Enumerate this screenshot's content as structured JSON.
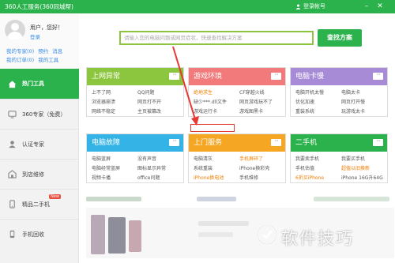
{
  "window": {
    "title": "360人工服务(360同城帮)",
    "login_label": "登录帐号",
    "minimize_icon": "minimize-icon",
    "close_icon": "close-icon"
  },
  "user": {
    "greeting": "用户，您好！",
    "logout": "登录",
    "links_row1": [
      "我的专家(0)",
      "预约",
      "消息"
    ],
    "links_row2": [
      "我的订单(0)",
      "我的工具"
    ]
  },
  "sidebar": {
    "items": [
      {
        "label": "热门工具",
        "icon": "home-icon",
        "active": true
      },
      {
        "label": "360专家（免费）",
        "icon": "expert-icon",
        "active": false
      },
      {
        "label": "认证专家",
        "icon": "certified-icon",
        "active": false
      },
      {
        "label": "到店维修",
        "icon": "repair-icon",
        "active": false
      },
      {
        "label": "精品二手机",
        "icon": "phone-icon",
        "active": false,
        "badge": "New"
      },
      {
        "label": "手机回收",
        "icon": "recycle-icon",
        "active": false
      }
    ]
  },
  "search": {
    "placeholder": "请输入您的电脑问题或网页症状，快速查找解决方案",
    "button": "查找方案"
  },
  "cards": [
    {
      "title": "上网异常",
      "color": "#8cc63f",
      "items": [
        "上不了网",
        "QQ问题",
        "浏览器崩溃",
        "网页打不开",
        "网络不稳定",
        "主页被篡改"
      ]
    },
    {
      "title": "游戏环境",
      "color": "#f27a7a",
      "items": [
        "绝地求生",
        "CF穿越火线",
        "缺少***.dll文件",
        "网页游戏玩不了",
        "游戏运行卡",
        "游戏图黑卡"
      ]
    },
    {
      "title": "电脑卡慢",
      "color": "#a78bd6",
      "items": [
        "电脑开机太慢",
        "电脑太卡",
        "优化加速",
        "网页打开慢",
        "重装系统",
        "玩游戏太卡"
      ]
    },
    {
      "title": "电脑故障",
      "color": "#33b3e6",
      "items": [
        "电脑蓝屏",
        "没有声音",
        "电脑经常蓝屏",
        "图标显示异常",
        "视频卡播",
        "office问题"
      ]
    },
    {
      "title": "上门服务",
      "color": "#f5a623",
      "items": [
        "电脑清灰",
        "手机屏碎了",
        "系统重装",
        "iPhone换彩壳",
        "iPhone换电池",
        "手机维修"
      ]
    },
    {
      "title": "二手机",
      "color": "#2bb24c",
      "items": [
        "我要卖手机",
        "我要买手机",
        "手机估值",
        "超值以旧换新",
        "6折买iPhone",
        "iPhone 16G升64G"
      ]
    }
  ],
  "watermark": {
    "text": "软件技巧"
  }
}
